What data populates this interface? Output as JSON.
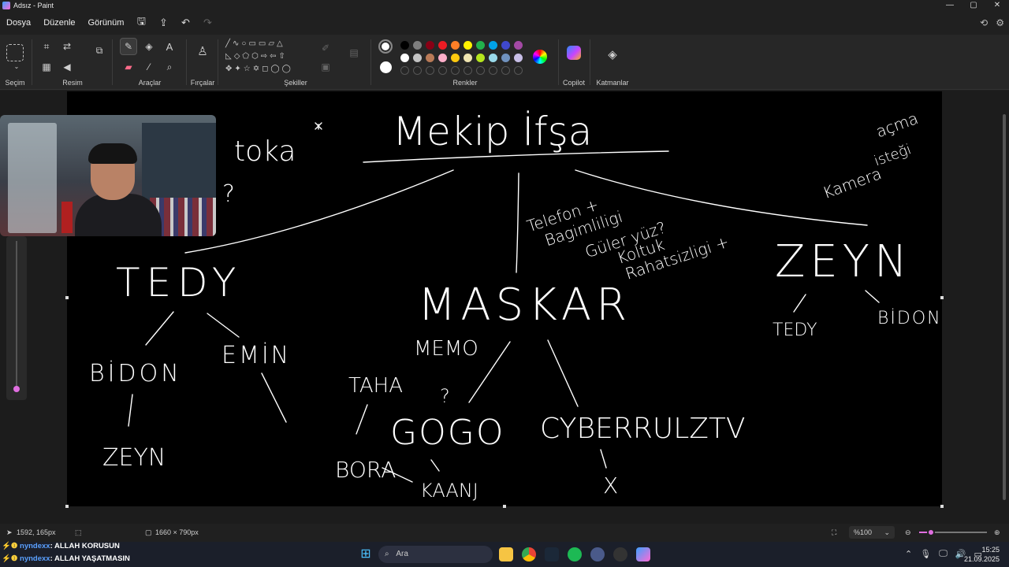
{
  "window": {
    "title": "Adsız - Paint",
    "controls": [
      "—",
      "▢",
      "✕"
    ]
  },
  "menu": {
    "items": [
      "Dosya",
      "Düzenle",
      "Görünüm"
    ]
  },
  "ribbon": {
    "groups": {
      "selection": "Seçim",
      "image": "Resim",
      "tools": "Araçlar",
      "brushes": "Fırçalar",
      "shapes": "Şekiller",
      "colors": "Renkler",
      "copilot": "Copilot",
      "layers": "Katmanlar"
    },
    "palette_row1": [
      "#000000",
      "#7f7f7f",
      "#880015",
      "#ed1c24",
      "#ff7f27",
      "#fff200",
      "#22b14c",
      "#00a2e8",
      "#3f48cc",
      "#a349a4"
    ],
    "palette_row2": [
      "#ffffff",
      "#c3c3c3",
      "#b97a57",
      "#ffaec9",
      "#ffc90e",
      "#efe4b0",
      "#b5e61d",
      "#99d9ea",
      "#7092be",
      "#c8bfe7"
    ],
    "primary_color": "#ffffff",
    "secondary_color": "#ffffff",
    "accent": "#0078d4"
  },
  "drawing": {
    "title": "Mekip İfşa",
    "left_branch": {
      "name": "TEDY",
      "children": [
        "BİDON",
        "EMİN"
      ],
      "grandchild": "ZEYN"
    },
    "top_left_note": "toka",
    "question_mark": "?",
    "center_branch": {
      "name": "MASKAR",
      "children": [
        "MEMO",
        "TAHA",
        "GOGO",
        "CYBERRULZTV"
      ],
      "extra": [
        "BORA",
        "KAANJ",
        "X"
      ],
      "qmark": "?"
    },
    "notes": [
      "Telefon +",
      "Bagimliligi",
      "Güler yüz?",
      "Koltuk",
      "Rahatsizligi +"
    ],
    "right_branch": {
      "name": "ZEYN",
      "children": [
        "TEDY",
        "BİDON"
      ]
    },
    "top_right_note": [
      "Kamera",
      "açma",
      "isteği"
    ]
  },
  "status": {
    "cursor_pos": "1592, 165px",
    "canvas_size": "1660 × 790px",
    "zoom": "%100"
  },
  "chat": [
    {
      "user": "nyndexx",
      "message": ": ALLAH KORUSUN"
    },
    {
      "user": "nyndexx",
      "message": ": ALLAH YAŞATMASIN"
    }
  ],
  "taskbar": {
    "search_placeholder": "Ara",
    "time": "15:25",
    "date": "21.09.2025"
  }
}
